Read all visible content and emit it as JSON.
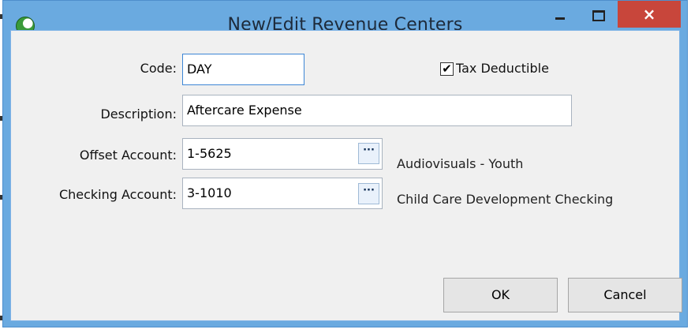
{
  "window": {
    "title": "New/Edit Revenue Centers",
    "close_glyph": "×"
  },
  "form": {
    "code_label": "Code:",
    "code_value": "DAY",
    "tax_deductible_label": "Tax Deductible",
    "tax_deductible_checked": true,
    "check_glyph": "✔",
    "description_label": "Description:",
    "description_value": "Aftercare Expense",
    "offset_label": "Offset Account:",
    "offset_value": "1-5625",
    "offset_desc": "Audiovisuals - Youth",
    "checking_label": "Checking Account:",
    "checking_value": "3-1010",
    "checking_desc": "Child Care Development Checking",
    "lookup_glyph": "···"
  },
  "buttons": {
    "ok": "OK",
    "cancel": "Cancel"
  },
  "icons": [
    "app-icon",
    "minimize-icon",
    "maximize-icon",
    "close-icon",
    "checkmark-icon",
    "ellipsis-icon"
  ]
}
